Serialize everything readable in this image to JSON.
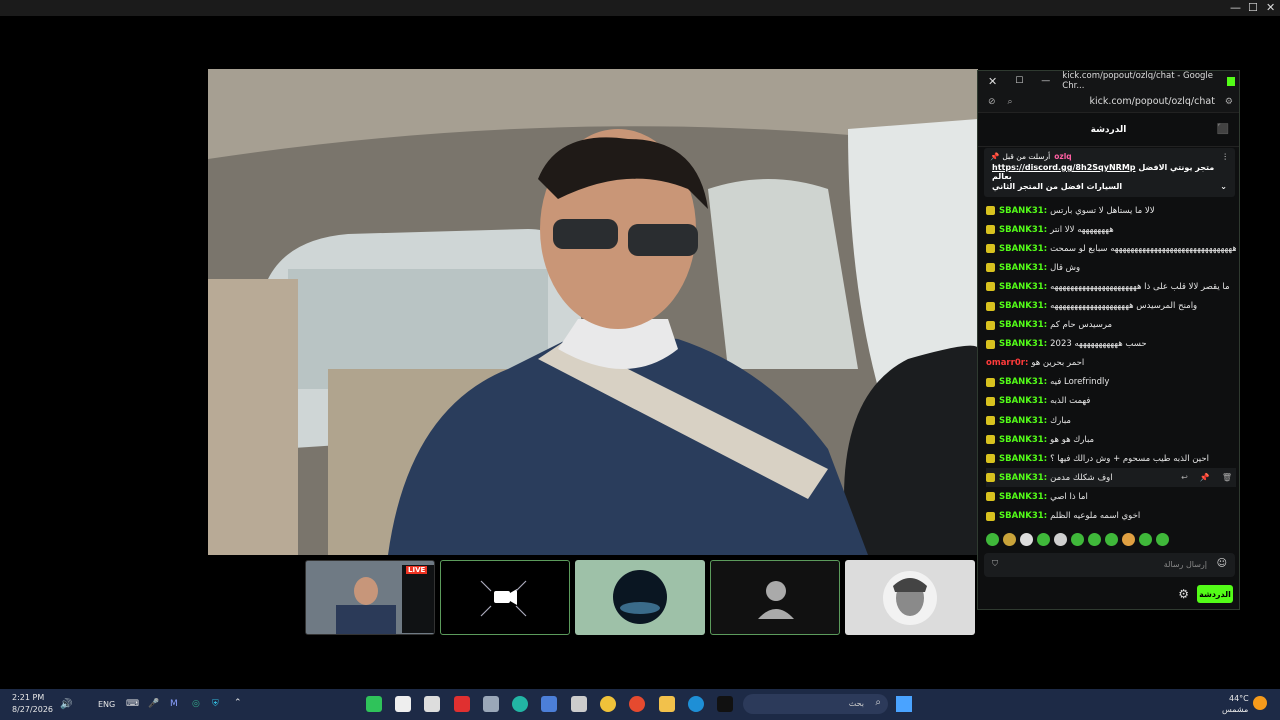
{
  "window_controls": {
    "minimize": "—",
    "maximize": "☐",
    "close": "✕"
  },
  "chat_window": {
    "title": "kick.com/popout/ozlq/chat - Google Chr...",
    "url": "kick.com/popout/ozlq/chat",
    "header": "الدردشة",
    "pinned": {
      "by_user": "ozlq",
      "by_label": "أرسلت من قبل",
      "link": "https://discord.gg/8h2SqyNRMp",
      "text_1": "متجر يونتي الافضل بعالم",
      "text_2": "السيارات افضل من المتجر الثاني"
    },
    "messages": [
      {
        "user": "SBANK31",
        "text": "لالا ما يستاهل لا تسوي بارتس",
        "color": "green"
      },
      {
        "user": "SBANK31",
        "text": "ههههههههه لالا انتر",
        "color": "green"
      },
      {
        "user": "SBANK31",
        "text": "هههههههههههههههههههههههههههههههه سبابع لو سمحت",
        "color": "green"
      },
      {
        "user": "SBANK31",
        "text": "وش قال",
        "color": "green"
      },
      {
        "user": "SBANK31",
        "text": "ما يقصر لالا قلب على ذا ههههههههههههههههههههههه",
        "color": "green"
      },
      {
        "user": "SBANK31",
        "text": "وامنح المرسيدس ههههههههههههههههههههه",
        "color": "green"
      },
      {
        "user": "SBANK31",
        "text": "مرسيدس حام كم",
        "color": "green"
      },
      {
        "user": "SBANK31",
        "text": "2023 حسب هههههههههههه",
        "color": "green"
      },
      {
        "user": "omarr0r",
        "text": "احمر بحرين هو",
        "color": "red"
      },
      {
        "user": "SBANK31",
        "text": "فيه Lorefrindly",
        "color": "green"
      },
      {
        "user": "SBANK31",
        "text": "فهمت الذبه",
        "color": "green"
      },
      {
        "user": "SBANK31",
        "text": "مبارك",
        "color": "green"
      },
      {
        "user": "SBANK31",
        "text": "مبارك هو هو",
        "color": "green"
      },
      {
        "user": "SBANK31",
        "text": "احين الذبه طيب مسحوم + وش درالك فيها ؟",
        "color": "green"
      },
      {
        "user": "SBANK31",
        "text": "اوف شكلك مدمن",
        "color": "green"
      },
      {
        "user": "SBANK31",
        "text": "اما ذا اصي",
        "color": "green"
      },
      {
        "user": "SBANK31",
        "text": "اخوي اسمه ملوعيه الظلم",
        "color": "green"
      }
    ],
    "input_placeholder": "إرسال رسالة",
    "send_label": "الدردشة"
  },
  "thumbs": {
    "live_badge": "LIVE"
  },
  "taskbar": {
    "time": "2:21 PM",
    "date": "8/27/2026",
    "lang": "ENG",
    "search_placeholder": "بحث",
    "weather_temp": "44°C",
    "weather_text": "مشمس"
  },
  "colors": {
    "accent": "#53fc18",
    "chat_bg": "#0e0f10",
    "taskbar": "#1d2a46"
  }
}
